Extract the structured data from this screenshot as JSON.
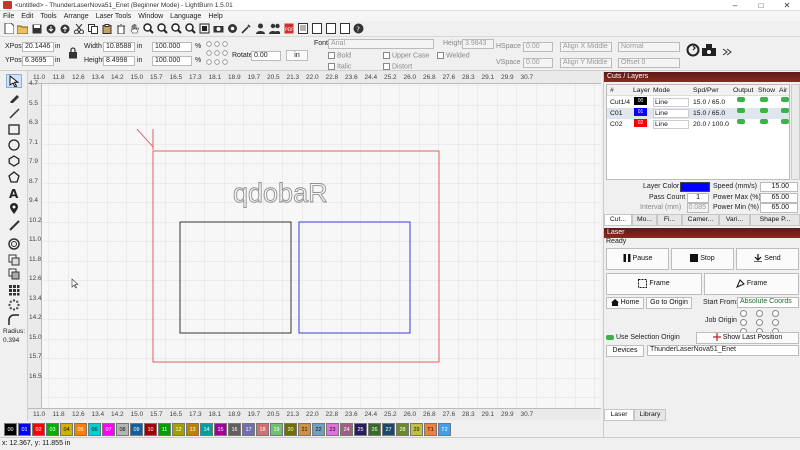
{
  "window": {
    "title": "<untitled> - ThunderLaserNova51_Enet (Beginner Mode) - LightBurn 1.5.01"
  },
  "menu": [
    "File",
    "Edit",
    "Tools",
    "Arrange",
    "Laser Tools",
    "Window",
    "Language",
    "Help"
  ],
  "props": {
    "xpos_label": "XPos",
    "xpos": "20.1446",
    "ypos_label": "YPos",
    "ypos": "6.3695",
    "unit1": "in",
    "unit2": "in",
    "width_label": "Width",
    "width": "10.8588",
    "height_label": "Height",
    "height": "8.4998",
    "unit3": "in",
    "unit4": "in",
    "pct_w": "100.000",
    "pct_h": "100.000",
    "pct": "%",
    "rotate_label": "Rotate",
    "rotate": "0.00",
    "in_button": "in",
    "font_label": "Font",
    "font": "Arial",
    "height2_label": "Height",
    "height2": "3.9843",
    "hspace_label": "HSpace",
    "hspace": "0.00",
    "vspace_label": "VSpace",
    "vspace": "0.00",
    "bold": "Bold",
    "italic": "Italic",
    "upper_case": "Upper Case",
    "distort": "Distort",
    "welded": "Welded",
    "alignx": "Align X Middle",
    "aligny": "Align Y Middle",
    "normal": "Normal",
    "offset": "Offset 0"
  },
  "ruler": {
    "h": [
      "11.0",
      "11.8",
      "12.6",
      "13.4",
      "14.2",
      "15.0",
      "15.7",
      "16.5",
      "17.3",
      "18.1",
      "18.9",
      "19.7",
      "20.5",
      "21.3",
      "22.0",
      "22.8",
      "23.6",
      "24.4",
      "25.2",
      "26.0",
      "26.8",
      "27.6",
      "28.3",
      "29.1",
      "29.9",
      "30.7"
    ],
    "h_bottom": [
      "11.0",
      "11.8",
      "12.6",
      "13.4",
      "14.2",
      "15.0",
      "15.7",
      "16.5",
      "17.3",
      "18.1",
      "18.9",
      "19.7",
      "20.5",
      "21.3",
      "22.0",
      "22.8",
      "23.6",
      "24.4",
      "25.2",
      "26.0",
      "26.8",
      "27.6",
      "28.3",
      "29.1",
      "29.9",
      "30.7"
    ],
    "v": [
      "4.7",
      "5.5",
      "6.3",
      "7.1",
      "7.9",
      "8.7",
      "9.4",
      "10.2",
      "11.0",
      "11.8",
      "12.6",
      "13.4",
      "14.2",
      "15.0",
      "15.7",
      "16.5"
    ]
  },
  "canvas_text": "qdobaR",
  "radius": {
    "label": "Radius:",
    "value": "0.394"
  },
  "palette": [
    {
      "label": "00",
      "color": "#000000"
    },
    {
      "label": "01",
      "color": "#0000ff"
    },
    {
      "label": "02",
      "color": "#ff0000"
    },
    {
      "label": "03",
      "color": "#00b000"
    },
    {
      "label": "04",
      "color": "#d0b000"
    },
    {
      "label": "05",
      "color": "#ff8000"
    },
    {
      "label": "06",
      "color": "#00d0d0"
    },
    {
      "label": "07",
      "color": "#ff00ff"
    },
    {
      "label": "08",
      "color": "#b4b4b4"
    },
    {
      "label": "09",
      "color": "#1060a0"
    },
    {
      "label": "10",
      "color": "#a00000"
    },
    {
      "label": "11",
      "color": "#00a000"
    },
    {
      "label": "12",
      "color": "#a0a000"
    },
    {
      "label": "13",
      "color": "#c08000"
    },
    {
      "label": "14",
      "color": "#00a0a0"
    },
    {
      "label": "15",
      "color": "#a000a0"
    },
    {
      "label": "16",
      "color": "#606060"
    },
    {
      "label": "17",
      "color": "#7070b0"
    },
    {
      "label": "18",
      "color": "#d07070"
    },
    {
      "label": "19",
      "color": "#70c070"
    },
    {
      "label": "20",
      "color": "#707000"
    },
    {
      "label": "21",
      "color": "#d09040"
    },
    {
      "label": "22",
      "color": "#70a0c0"
    },
    {
      "label": "23",
      "color": "#e070e0"
    },
    {
      "label": "24",
      "color": "#a06080"
    },
    {
      "label": "25",
      "color": "#2a1a5e"
    },
    {
      "label": "26",
      "color": "#3a6a2a"
    },
    {
      "label": "27",
      "color": "#1a4a6a"
    },
    {
      "label": "28",
      "color": "#6a8a2a"
    },
    {
      "label": "29",
      "color": "#c0c040"
    },
    {
      "label": "T1",
      "color": "#f08040"
    },
    {
      "label": "T2",
      "color": "#40a0f0"
    }
  ],
  "status": "x: 12.367, y: 11.855 in",
  "cuts": {
    "header": "Cuts / Layers",
    "cols": [
      "#",
      "Layer",
      "Mode",
      "Spd/Pwr",
      "Output",
      "Show",
      "Air"
    ],
    "rows": [
      {
        "num": "Cut1/4",
        "layer": "00",
        "color": "#000000",
        "mode": "Line",
        "spd": "15.0 / 65.0"
      },
      {
        "num": "C01",
        "layer": "01",
        "color": "#0000ff",
        "mode": "Line",
        "spd": "15.0 / 65.0"
      },
      {
        "num": "C02",
        "layer": "02",
        "color": "#ff0000",
        "mode": "Line",
        "spd": "20.0 / 100.0"
      }
    ],
    "layer_color_label": "Layer Color",
    "layer_color": "#0000ff",
    "speed_label": "Speed (mm/s)",
    "speed": "15.00",
    "pass_label": "Pass Count",
    "pass": "1",
    "pmax_label": "Power Max (%)",
    "pmax": "65.00",
    "interval_label": "Interval (mm)",
    "interval": "0.085",
    "pmin_label": "Power Min (%)",
    "pmin": "65.00",
    "tabs": [
      "Cut...",
      "Mo...",
      "Fi...",
      "Camer...",
      "Vari...",
      "Shape P..."
    ]
  },
  "laser": {
    "header": "Laser",
    "status": "Ready",
    "pause": "Pause",
    "stop": "Stop",
    "send": "Send",
    "frame1": "Frame",
    "frame2": "Frame",
    "home": "Home",
    "goto": "Go to Origin",
    "start_from_label": "Start From:",
    "start_from": "Absolute Coords",
    "job_origin": "Job Origin",
    "use_sel": "Use Selection Origin",
    "show_last": "Show Last Position",
    "devices": "Devices",
    "device": "ThunderLaserNova51_Enet",
    "tabs": [
      "Laser",
      "Library"
    ]
  }
}
